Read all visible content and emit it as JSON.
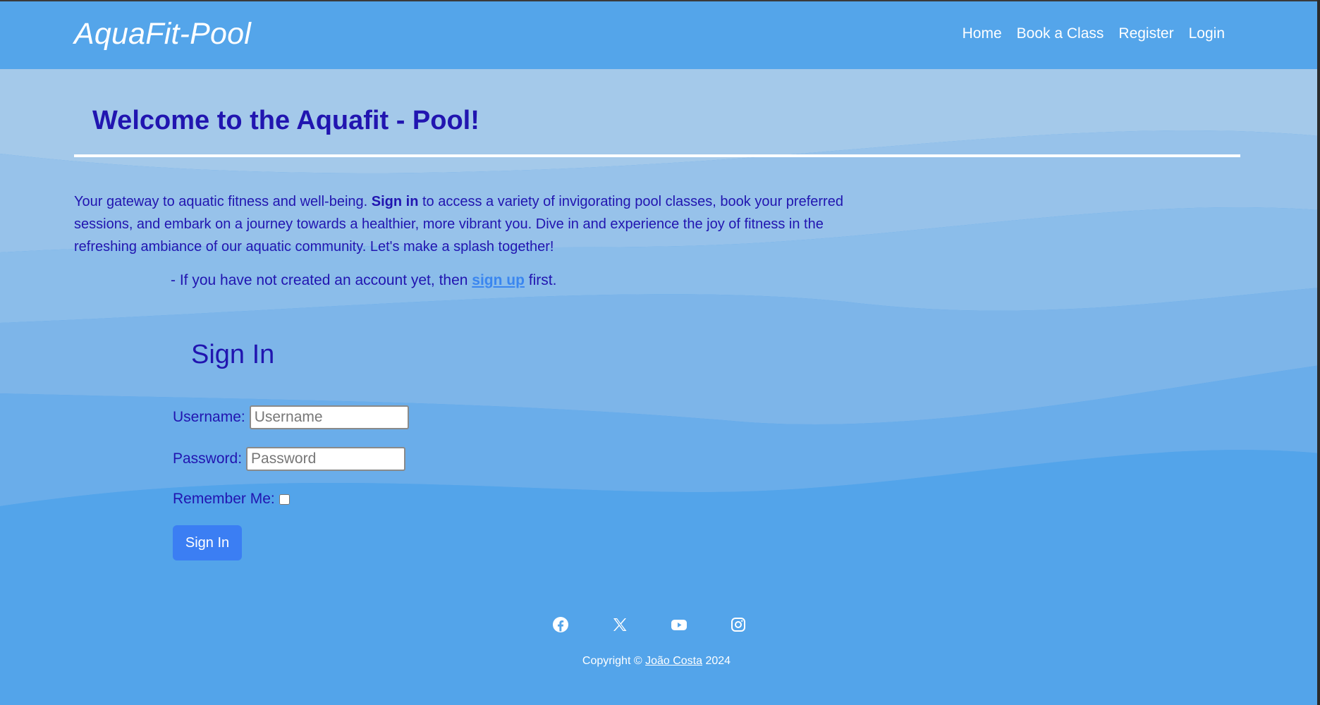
{
  "brand": {
    "name": "AquaFit-Pool"
  },
  "nav": {
    "items": [
      {
        "label": "Home"
      },
      {
        "label": "Book a Class"
      },
      {
        "label": "Register"
      },
      {
        "label": "Login"
      }
    ]
  },
  "main": {
    "heading": "Welcome to the Aquafit - Pool!",
    "intro_before": "Your gateway to aquatic fitness and well-being. ",
    "intro_bold": "Sign in",
    "intro_after": " to access a variety of invigorating pool classes, book your preferred sessions, and embark on a journey towards a healthier, more vibrant you. Dive in and experience the joy of fitness in the refreshing ambiance of our aquatic community. Let's make a splash together!",
    "note_before": "- If you have not created an account yet, then ",
    "note_link": "sign up",
    "note_after": " first."
  },
  "form": {
    "title": "Sign In",
    "username_label": "Username:",
    "username_placeholder": "Username",
    "username_value": "",
    "password_label": "Password:",
    "password_placeholder": "Password",
    "password_value": "",
    "remember_label": "Remember Me:",
    "remember_checked": false,
    "submit_label": "Sign In"
  },
  "footer": {
    "social_icons": [
      "facebook-icon",
      "x-icon",
      "youtube-icon",
      "instagram-icon"
    ],
    "copyright_prefix": "Copyright © ",
    "copyright_name": "João Costa",
    "copyright_suffix": " 2024"
  },
  "colors": {
    "navbar": "#54a5ea",
    "heading_text": "#2115b0",
    "link": "#3a86f0",
    "button": "#3b7ef3",
    "bg_light": "#a3c9ea",
    "bg_dark": "#53a4ea"
  }
}
